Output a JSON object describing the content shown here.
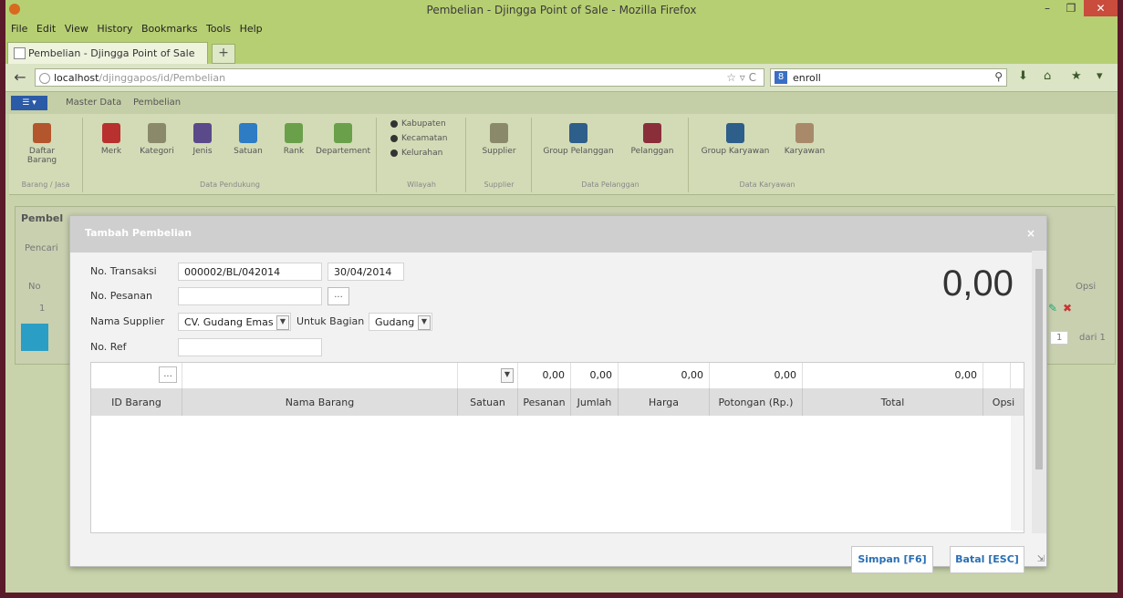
{
  "window": {
    "title": "Pembelian - Djingga Point of Sale - Mozilla Firefox",
    "minimize": "–",
    "maximize": "❐",
    "close": "✕"
  },
  "menu": [
    "File",
    "Edit",
    "View",
    "History",
    "Bookmarks",
    "Tools",
    "Help"
  ],
  "browser": {
    "tab_label": "Pembelian - Djingga Point of Sale",
    "new_tab": "+",
    "url_host": "localhost",
    "url_path": "/djinggapos/id/Pembelian",
    "search_query": "enroll",
    "search_engine_badge": "8"
  },
  "app": {
    "menu_button": "☰ ▾",
    "tabs": [
      "Master Data",
      "Pembelian"
    ]
  },
  "ribbon": {
    "groups": [
      {
        "label": "Barang / Jasa",
        "items": [
          "Daftar Barang"
        ]
      },
      {
        "label": "Data Pendukung",
        "items": [
          "Merk",
          "Kategori",
          "Jenis",
          "Satuan",
          "Rank",
          "Departement"
        ]
      },
      {
        "label": "Wilayah",
        "items": [
          "Kabupaten",
          "Kecamatan",
          "Kelurahan"
        ]
      },
      {
        "label": "Supplier",
        "items": [
          "Supplier"
        ]
      },
      {
        "label": "Data Pelanggan",
        "items": [
          "Group Pelanggan",
          "Pelanggan"
        ]
      },
      {
        "label": "Data Karyawan",
        "items": [
          "Group Karyawan",
          "Karyawan"
        ]
      }
    ]
  },
  "background_panel": {
    "title": "Pembel",
    "search_label": "Pencari",
    "col_no": "No",
    "row_no": "1",
    "opsi": "Opsi",
    "page_of": "dari 1",
    "page_value": "1"
  },
  "modal": {
    "title": "Tambah Pembelian",
    "close": "×",
    "labels": {
      "no_transaksi": "No. Transaksi",
      "no_pesanan": "No. Pesanan",
      "nama_supplier": "Nama Supplier",
      "untuk_bagian": "Untuk Bagian",
      "no_ref": "No. Ref"
    },
    "values": {
      "no_transaksi": "000002/BL/042014",
      "tanggal": "30/04/2014",
      "no_pesanan": "",
      "supplier": "CV. Gudang Emas",
      "bagian": "Gudang",
      "no_ref": ""
    },
    "dots": "...",
    "total_display": "0,00",
    "input_row": {
      "pesanan": "0,00",
      "jumlah": "0,00",
      "harga": "0,00",
      "potongan": "0,00",
      "total": "0,00"
    },
    "columns": [
      "ID Barang",
      "Nama Barang",
      "Satuan",
      "Pesanan",
      "Jumlah",
      "Harga",
      "Potongan (Rp.)",
      "Total",
      "Opsi"
    ],
    "buttons": {
      "save": "Simpan [F6]",
      "cancel": "Batal [ESC]"
    }
  },
  "colors": {
    "titlebar": "#b7cf73",
    "button_text": "#2a6fb4",
    "app_menu": "#2b5aa6"
  }
}
